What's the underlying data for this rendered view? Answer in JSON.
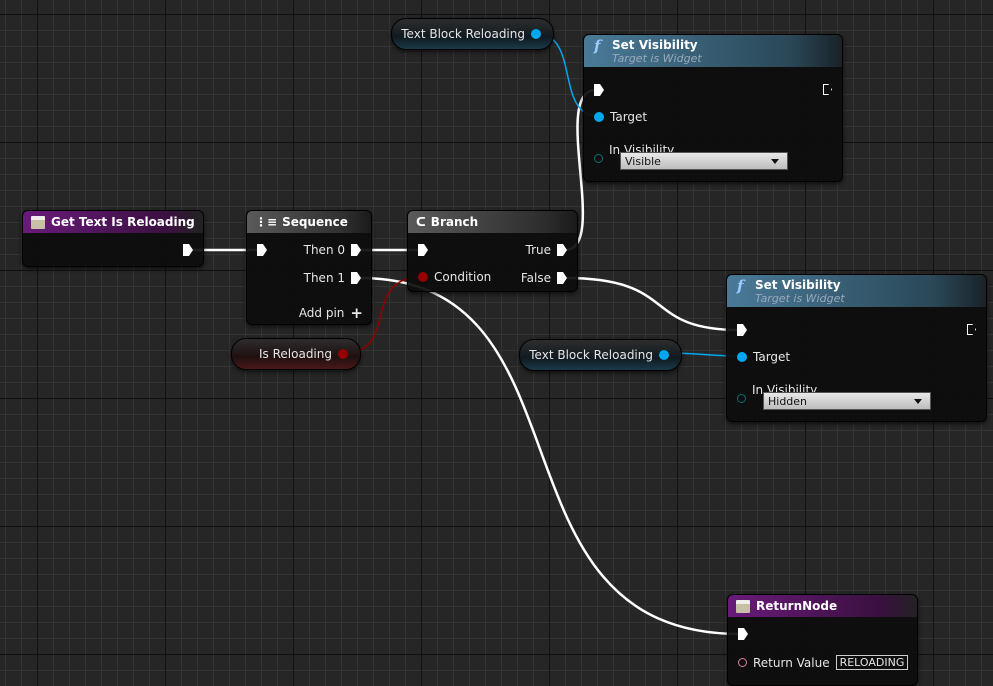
{
  "nodes": {
    "get_text": {
      "title": "Get Text Is Reloading",
      "icon": "function-entry-icon"
    },
    "sequence": {
      "title": "Sequence",
      "then0": "Then 0",
      "then1": "Then 1",
      "add_pin": "Add pin"
    },
    "branch": {
      "title": "Branch",
      "condition": "Condition",
      "true": "True",
      "false": "False"
    },
    "set_vis_1": {
      "title": "Set Visibility",
      "subtitle": "Target is Widget",
      "target": "Target",
      "in_visibility": "In Visibility",
      "value": "Visible"
    },
    "set_vis_2": {
      "title": "Set Visibility",
      "subtitle": "Target is Widget",
      "target": "Target",
      "in_visibility": "In Visibility",
      "value": "Hidden"
    },
    "var_tb_1": {
      "label": "Text Block Reloading"
    },
    "var_tb_2": {
      "label": "Text Block Reloading"
    },
    "var_is_reloading": {
      "label": "Is Reloading"
    },
    "return": {
      "title": "ReturnNode",
      "return_value": "Return Value",
      "value": "RELOADING"
    }
  },
  "colors": {
    "exec": "#ffffff",
    "object": "#00a8f0",
    "bool": "#950000",
    "text": "#e07ca0",
    "enum": "#006060",
    "pure_header": "#6a1b7a"
  }
}
